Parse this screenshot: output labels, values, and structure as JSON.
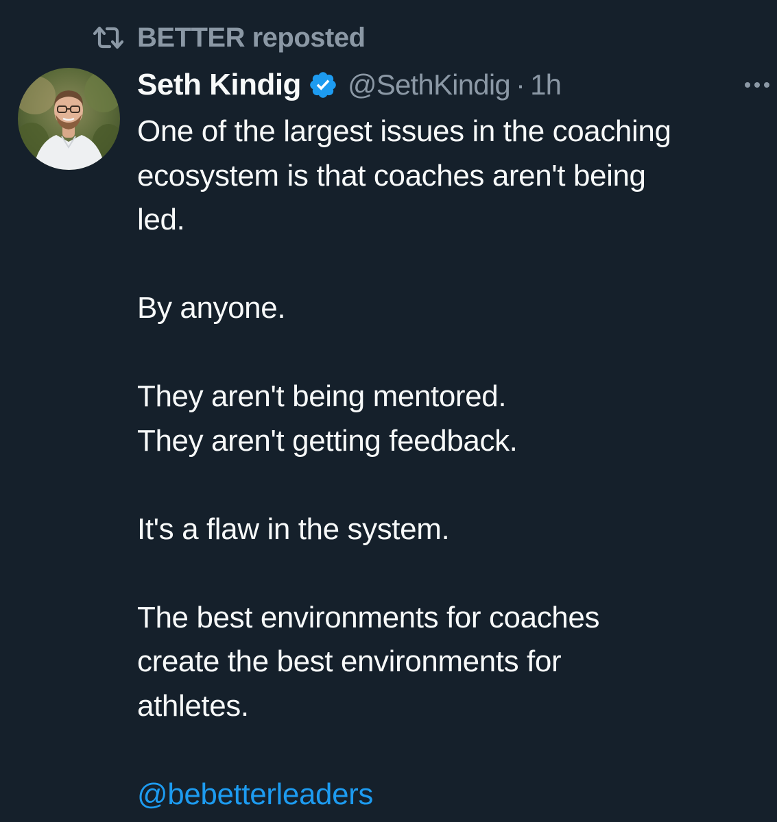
{
  "repost": {
    "icon": "repost-icon",
    "text": "BETTER reposted"
  },
  "author": {
    "avatar_icon": "avatar",
    "name": "Seth Kindig",
    "verified_icon": "verified-badge-icon",
    "handle": "@SethKindig",
    "separator": "·",
    "time": "1h"
  },
  "more_menu": {
    "icon": "more-horizontal-icon"
  },
  "tweet": {
    "lines": [
      "One of the largest issues in the coaching",
      "ecosystem is that coaches aren't being",
      "led.",
      "By anyone.",
      "They aren't being mentored.",
      "They aren't getting feedback.",
      "It's a flaw in the system.",
      "The best environments for coaches",
      "create the best environments for",
      "athletes."
    ],
    "mention": "@bebetterleaders"
  },
  "colors": {
    "background": "#15202b",
    "text": "#f7f9f9",
    "secondary": "#8b98a5",
    "accent": "#1d9bf0"
  }
}
